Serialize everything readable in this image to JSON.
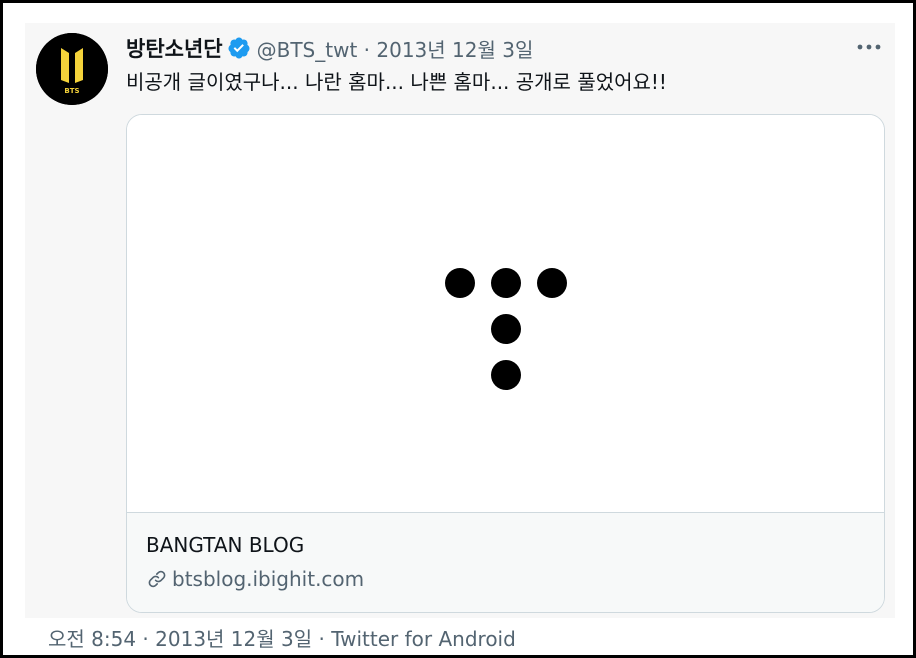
{
  "tweet": {
    "author_name": "방탄소년단",
    "handle": "@BTS_twt",
    "separator": " · ",
    "date": "2013년 12월 3일",
    "text": "비공개 글이였구나... 나란 홈마... 나쁜 홈마... 공개로 풀었어요!!",
    "avatar_logo_text": "BTS",
    "verified_icon": "verified-badge-icon",
    "more_icon": "more-options-icon"
  },
  "card": {
    "title": "BANGTAN BLOG",
    "link": "btsblog.ibighit.com",
    "link_icon": "link-icon",
    "image": "tistory-logo"
  },
  "footer": {
    "time": "오전 8:54",
    "separator1": " · ",
    "date": "2013년 12월 3일",
    "separator2": " · ",
    "client": "Twitter for Android"
  },
  "colors": {
    "verified": "#1d9bf0",
    "avatar_gold": "#f5d33b",
    "secondary_text": "#536471",
    "primary_text": "#0f1419"
  }
}
